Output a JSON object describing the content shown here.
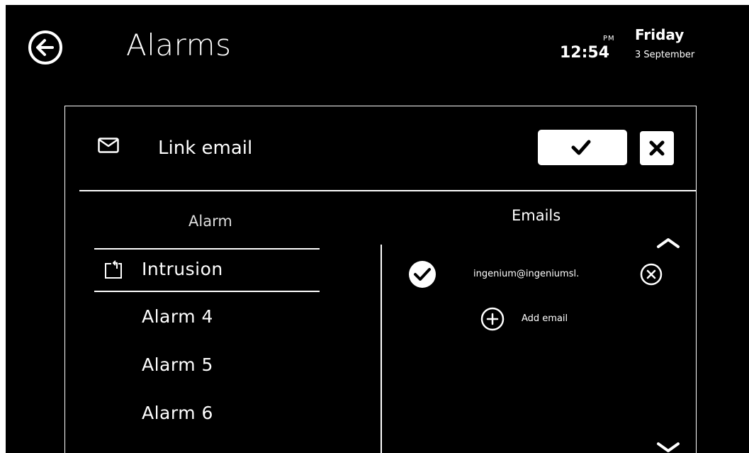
{
  "header": {
    "title": "Alarms",
    "ampm": "PM",
    "time": "12:54",
    "day": "Friday",
    "date": "3 September"
  },
  "dialog": {
    "title": "Link email",
    "icon": "mail-icon",
    "confirm_icon": "check-icon",
    "close_icon": "close-icon"
  },
  "alarms": {
    "header": "Alarm",
    "items": [
      {
        "label": "Intrusion",
        "selected": true,
        "icon": "intrusion-icon"
      },
      {
        "label": "Alarm 4",
        "selected": false
      },
      {
        "label": "Alarm 5",
        "selected": false
      },
      {
        "label": "Alarm 6",
        "selected": false
      }
    ]
  },
  "emails": {
    "header": "Emails",
    "items": [
      {
        "address": "ingenium@ingeniumsl.",
        "checked": true
      }
    ],
    "add_label": "Add email"
  },
  "colors": {
    "background": "#000000",
    "foreground": "#ffffff"
  }
}
